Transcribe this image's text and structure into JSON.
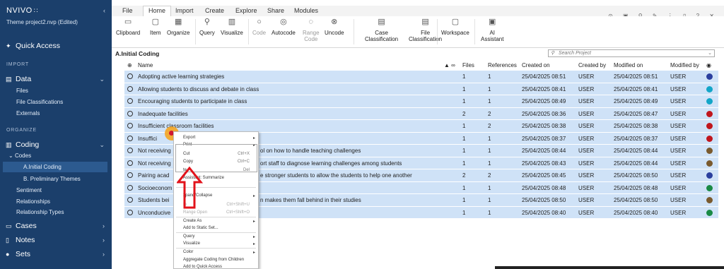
{
  "sidebar": {
    "logo": "NVIVO",
    "logo_dots": "∷",
    "collapse": "‹",
    "project": "Theme project2.nvp (Edited)",
    "quick_access": "Quick Access",
    "import_header": "IMPORT",
    "data": "Data",
    "files": "Files",
    "file_classifications": "File Classifications",
    "externals": "Externals",
    "organize_header": "ORGANIZE",
    "coding": "Coding",
    "codes": "Codes",
    "initial_coding": "A.Initial Coding",
    "prelim": "B. Preliminary Themes",
    "sentiment": "Sentiment",
    "relationships": "Relationships",
    "relationship_types": "Relationship Types",
    "cases": "Cases",
    "notes": "Notes",
    "sets": "Sets"
  },
  "tabs": [
    "File",
    "Home",
    "Import",
    "Create",
    "Explore",
    "Share",
    "Modules"
  ],
  "ribbon": {
    "clipboard": "Clipboard",
    "item": "Item",
    "organize": "Organize",
    "query": "Query",
    "visualize": "Visualize",
    "code": "Code",
    "autocode": "Autocode",
    "range_code": "Range\nCode",
    "uncode": "Uncode",
    "case_classification": "Case\nClassification",
    "file_classification": "File\nClassification",
    "workspace": "Workspace",
    "ai_assistant": "AI\nAssistant"
  },
  "content": {
    "breadcrumb": "A.Initial Coding",
    "search_placeholder": "Search Project"
  },
  "columns": {
    "name": "Name",
    "files": "Files",
    "references": "References",
    "created_on": "Created on",
    "created_by": "Created by",
    "modified_on": "Modified on",
    "modified_by": "Modified by"
  },
  "rows": [
    {
      "name": "Adopting  active learning strategies",
      "files": "1",
      "refs": "1",
      "created": "25/04/2025 08:51",
      "cby": "USER",
      "modified": "25/04/2025 08:51",
      "mby": "USER",
      "color": "#2a3f9e"
    },
    {
      "name": "Allowing students to discuss and debate in class",
      "files": "1",
      "refs": "1",
      "created": "25/04/2025 08:41",
      "cby": "USER",
      "modified": "25/04/2025 08:41",
      "mby": "USER",
      "color": "#13a6c8"
    },
    {
      "name": "Encouraging students to participate in class",
      "files": "1",
      "refs": "1",
      "created": "25/04/2025 08:49",
      "cby": "USER",
      "modified": "25/04/2025 08:49",
      "mby": "USER",
      "color": "#13a6c8"
    },
    {
      "name": "Inadequate facilities",
      "files": "2",
      "refs": "2",
      "created": "25/04/2025 08:36",
      "cby": "USER",
      "modified": "25/04/2025 08:47",
      "mby": "USER",
      "color": "#c0161d"
    },
    {
      "name": "Insufficient  classroom facilities",
      "files": "1",
      "refs": "2",
      "created": "25/04/2025 08:38",
      "cby": "USER",
      "modified": "25/04/2025 08:38",
      "mby": "USER",
      "color": "#c0161d"
    },
    {
      "name": "Insuffici",
      "files": "1",
      "refs": "1",
      "created": "25/04/2025 08:37",
      "cby": "USER",
      "modified": "25/04/2025 08:37",
      "mby": "USER",
      "color": "#c0161d"
    },
    {
      "name": "Not receiving",
      "tail": "ol on how to handle teaching challenges",
      "files": "1",
      "refs": "1",
      "created": "25/04/2025 08:44",
      "cby": "USER",
      "modified": "25/04/2025 08:44",
      "mby": "USER",
      "color": "#7a5a2e"
    },
    {
      "name": "Not receiving",
      "tail": "ort staff to diagnose learning challenges among students",
      "files": "1",
      "refs": "1",
      "created": "25/04/2025 08:43",
      "cby": "USER",
      "modified": "25/04/2025 08:44",
      "mby": "USER",
      "color": "#7a5a2e"
    },
    {
      "name": "Pairing acad",
      "tail": "e stronger students to allow the students to help one another",
      "files": "2",
      "refs": "2",
      "created": "25/04/2025 08:45",
      "cby": "USER",
      "modified": "25/04/2025 08:50",
      "mby": "USER",
      "color": "#2a3f9e"
    },
    {
      "name": "Socioeconom",
      "files": "1",
      "refs": "1",
      "created": "25/04/2025 08:48",
      "cby": "USER",
      "modified": "25/04/2025 08:48",
      "mby": "USER",
      "color": "#1a8a45"
    },
    {
      "name": "Students bei",
      "tail": "n makes them fall behind in their studies",
      "files": "1",
      "refs": "1",
      "created": "25/04/2025 08:50",
      "cby": "USER",
      "modified": "25/04/2025 08:50",
      "mby": "USER",
      "color": "#7a5a2e"
    },
    {
      "name": "Unconducive",
      "files": "1",
      "refs": "1",
      "created": "25/04/2025 08:40",
      "cby": "USER",
      "modified": "25/04/2025 08:40",
      "mby": "USER",
      "color": "#1a8a45"
    }
  ],
  "menu": {
    "export": "Export",
    "print": "Print",
    "cut": "Cut",
    "cut_sc": "Ctrl+X",
    "copy": "Copy",
    "copy_sc": "Ctrl+C",
    "delete": "te",
    "delete_sc": "Del",
    "summarize": "Assistant: Summarize",
    "expand": "xpand/Collapse",
    "ctx1": "lo",
    "ctx1_sc": "Ctrl+Shift+U",
    "ctx2": "Range Open",
    "ctx2_sc": "Ctrl+Shift+O",
    "create_as": "Create As",
    "add_static": "Add to Static Set...",
    "query": "Query",
    "visualize": "Visualize",
    "color": "Color",
    "aggregate": "Aggregate Coding from Children",
    "add_quick": "Add to Quick Access"
  }
}
